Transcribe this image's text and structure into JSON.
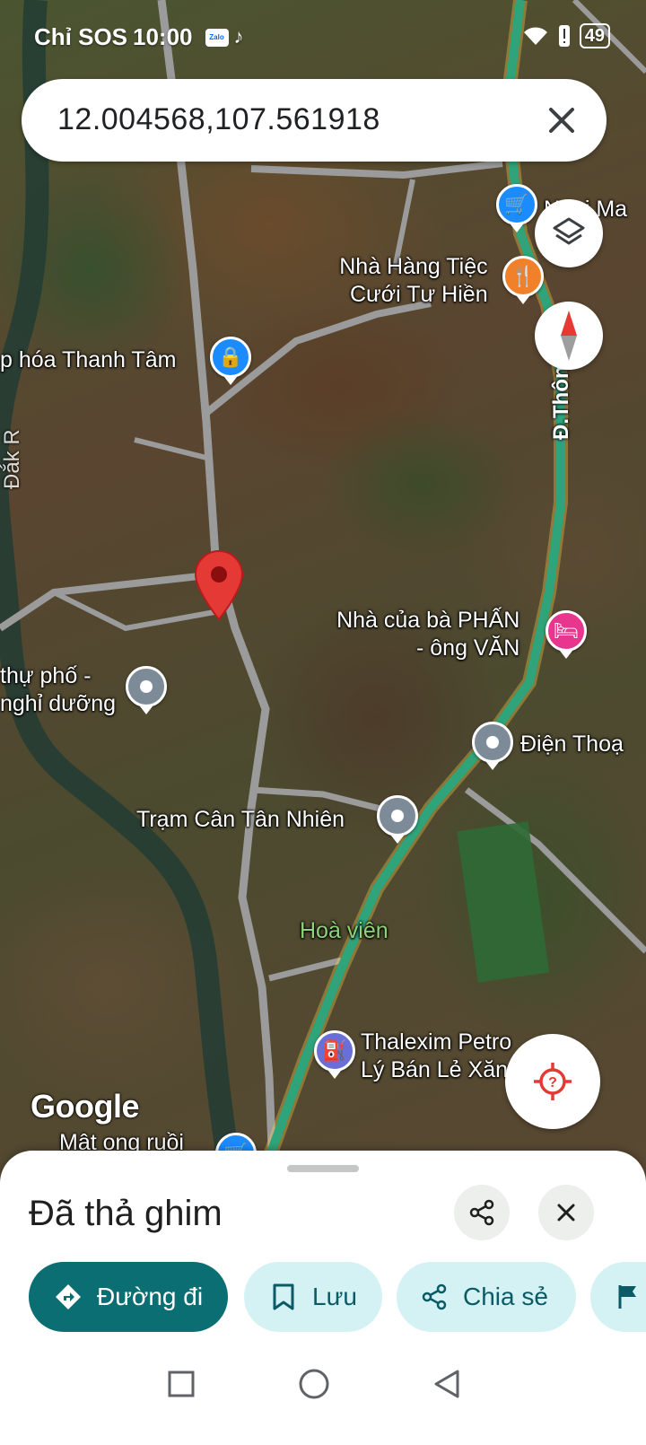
{
  "status_bar": {
    "carrier": "Chỉ SOS",
    "time": "10:00",
    "zalo_icon_label": "Zalo",
    "battery": "49"
  },
  "search": {
    "value": "12.004568,107.561918",
    "clear_icon": "close-icon"
  },
  "map": {
    "labels": {
      "shop_partial": "Ngọi Ma",
      "restaurant_line1": "Nhà Hàng Tiệc",
      "restaurant_line2": "Cưới Tư Hiền",
      "grocery": "p hóa Thanh Tâm",
      "road": "Đ.Thôn",
      "river": "Đắk R",
      "house_line1": "Nhà của bà PHẤN",
      "house_line2": "- ông VĂN",
      "villa_line1": "thự phố -",
      "villa_line2": "nghỉ dưỡng",
      "phone": "Điện Thoạ",
      "weigh_station": "Trạm Cân Tân Nhiên",
      "garden": "Hoà viên",
      "petrol_line1": "Thalexim Petro",
      "petrol_line2": "Lý Bán Lẻ Xăn",
      "honey": "Mật ong ruồi",
      "google": "Google"
    },
    "accent_road_color": "#2fa37a",
    "pin_color": "#e53935"
  },
  "sheet": {
    "title": "Đã thả ghim",
    "chips": {
      "directions": "Đường đi",
      "save": "Lưu",
      "share": "Chia sẻ"
    },
    "primary_color": "#0b6e73",
    "secondary_color": "#d4f1f4"
  }
}
